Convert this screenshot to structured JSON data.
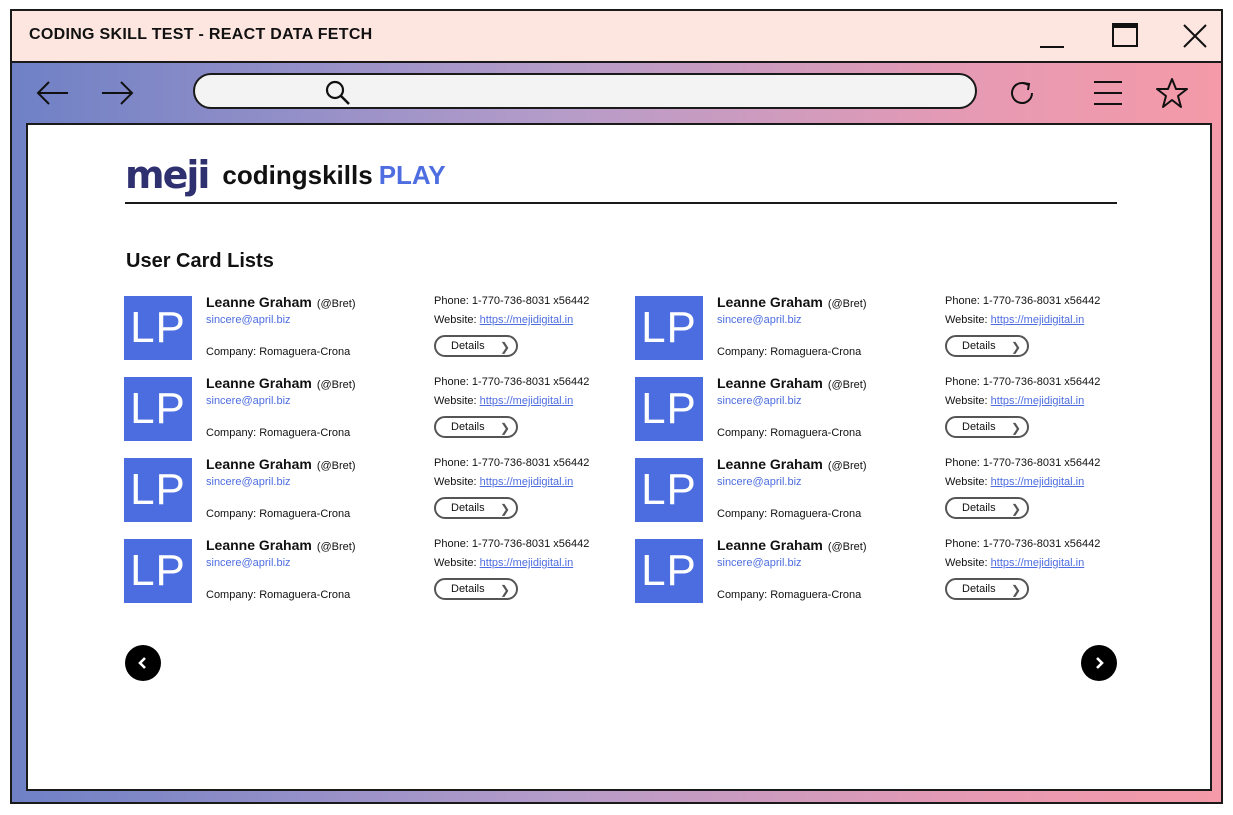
{
  "window": {
    "title": "CODING SKILL TEST -  REACT DATA FETCH"
  },
  "brand": {
    "logo": "meji",
    "name": "codingskills",
    "accent": "PLAY"
  },
  "section": {
    "title": "User Card Lists"
  },
  "cards": [
    {
      "initials": "LP",
      "name": "Leanne Graham",
      "handle": "(@Bret)",
      "email": "sincere@april.biz",
      "company": "Company: Romaguera-Crona",
      "phone": "Phone: 1-770-736-8031 x56442",
      "website_label": "Website: ",
      "website": "https://mejidigital.in",
      "details": "Details"
    },
    {
      "initials": "LP",
      "name": "Leanne Graham",
      "handle": "(@Bret)",
      "email": "sincere@april.biz",
      "company": "Company: Romaguera-Crona",
      "phone": "Phone: 1-770-736-8031 x56442",
      "website_label": "Website: ",
      "website": "https://mejidigital.in",
      "details": "Details"
    },
    {
      "initials": "LP",
      "name": "Leanne Graham",
      "handle": "(@Bret)",
      "email": "sincere@april.biz",
      "company": "Company: Romaguera-Crona",
      "phone": "Phone: 1-770-736-8031 x56442",
      "website_label": "Website: ",
      "website": "https://mejidigital.in",
      "details": "Details"
    },
    {
      "initials": "LP",
      "name": "Leanne Graham",
      "handle": "(@Bret)",
      "email": "sincere@april.biz",
      "company": "Company: Romaguera-Crona",
      "phone": "Phone: 1-770-736-8031 x56442",
      "website_label": "Website: ",
      "website": "https://mejidigital.in",
      "details": "Details"
    },
    {
      "initials": "LP",
      "name": "Leanne Graham",
      "handle": "(@Bret)",
      "email": "sincere@april.biz",
      "company": "Company: Romaguera-Crona",
      "phone": "Phone: 1-770-736-8031 x56442",
      "website_label": "Website: ",
      "website": "https://mejidigital.in",
      "details": "Details"
    },
    {
      "initials": "LP",
      "name": "Leanne Graham",
      "handle": "(@Bret)",
      "email": "sincere@april.biz",
      "company": "Company: Romaguera-Crona",
      "phone": "Phone: 1-770-736-8031 x56442",
      "website_label": "Website: ",
      "website": "https://mejidigital.in",
      "details": "Details"
    },
    {
      "initials": "LP",
      "name": "Leanne Graham",
      "handle": "(@Bret)",
      "email": "sincere@april.biz",
      "company": "Company: Romaguera-Crona",
      "phone": "Phone: 1-770-736-8031 x56442",
      "website_label": "Website: ",
      "website": "https://mejidigital.in",
      "details": "Details"
    },
    {
      "initials": "LP",
      "name": "Leanne Graham",
      "handle": "(@Bret)",
      "email": "sincere@april.biz",
      "company": "Company: Romaguera-Crona",
      "phone": "Phone: 1-770-736-8031 x56442",
      "website_label": "Website: ",
      "website": "https://mejidigital.in",
      "details": "Details"
    }
  ],
  "icons": {
    "back": "arrow-left-icon",
    "forward": "arrow-right-icon",
    "search": "search-icon",
    "reload": "reload-icon",
    "menu": "hamburger-menu-icon",
    "bookmark": "star-icon",
    "minimize": "minimize-icon",
    "maximize": "maximize-icon",
    "close": "close-icon",
    "prev": "chevron-left-icon",
    "next": "chevron-right-icon"
  },
  "colors": {
    "accent": "#4d6de0",
    "avatar": "#4b6de0",
    "logo": "#2f3070",
    "titlebar": "#fde6e0"
  }
}
